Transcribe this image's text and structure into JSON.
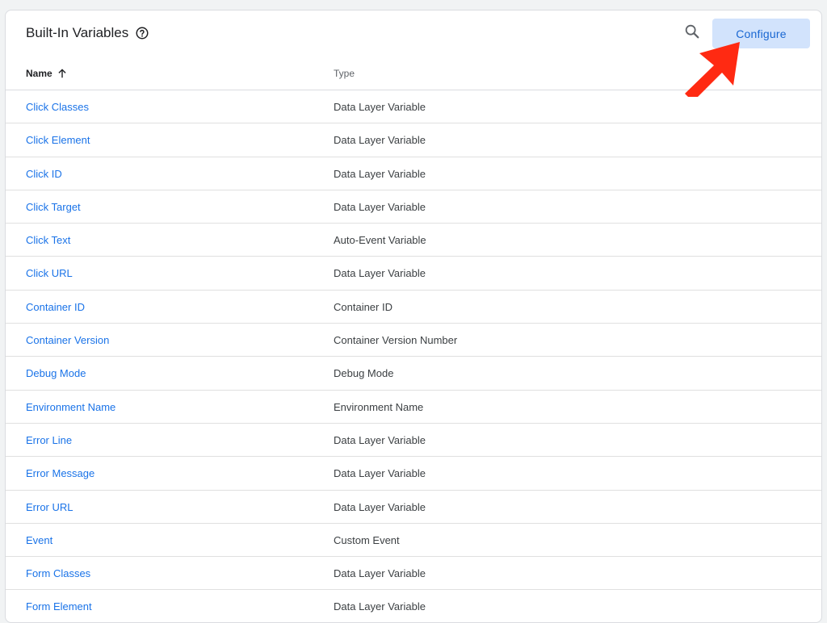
{
  "header": {
    "title": "Built-In Variables",
    "configure_label": "Configure"
  },
  "colors": {
    "link": "#1a73e8",
    "button_bg": "#d2e3fc",
    "button_text": "#1967d2",
    "arrow": "#ff2a12"
  },
  "icons": {
    "help": "help-circle-icon",
    "search": "search-icon",
    "sort": "arrow-up-icon",
    "annotation": "red-arrow-annotation"
  },
  "table": {
    "columns": {
      "name": "Name",
      "type": "Type"
    },
    "rows": [
      {
        "name": "Click Classes",
        "type": "Data Layer Variable"
      },
      {
        "name": "Click Element",
        "type": "Data Layer Variable"
      },
      {
        "name": "Click ID",
        "type": "Data Layer Variable"
      },
      {
        "name": "Click Target",
        "type": "Data Layer Variable"
      },
      {
        "name": "Click Text",
        "type": "Auto-Event Variable"
      },
      {
        "name": "Click URL",
        "type": "Data Layer Variable"
      },
      {
        "name": "Container ID",
        "type": "Container ID"
      },
      {
        "name": "Container Version",
        "type": "Container Version Number"
      },
      {
        "name": "Debug Mode",
        "type": "Debug Mode"
      },
      {
        "name": "Environment Name",
        "type": "Environment Name"
      },
      {
        "name": "Error Line",
        "type": "Data Layer Variable"
      },
      {
        "name": "Error Message",
        "type": "Data Layer Variable"
      },
      {
        "name": "Error URL",
        "type": "Data Layer Variable"
      },
      {
        "name": "Event",
        "type": "Custom Event"
      },
      {
        "name": "Form Classes",
        "type": "Data Layer Variable"
      },
      {
        "name": "Form Element",
        "type": "Data Layer Variable"
      }
    ]
  }
}
